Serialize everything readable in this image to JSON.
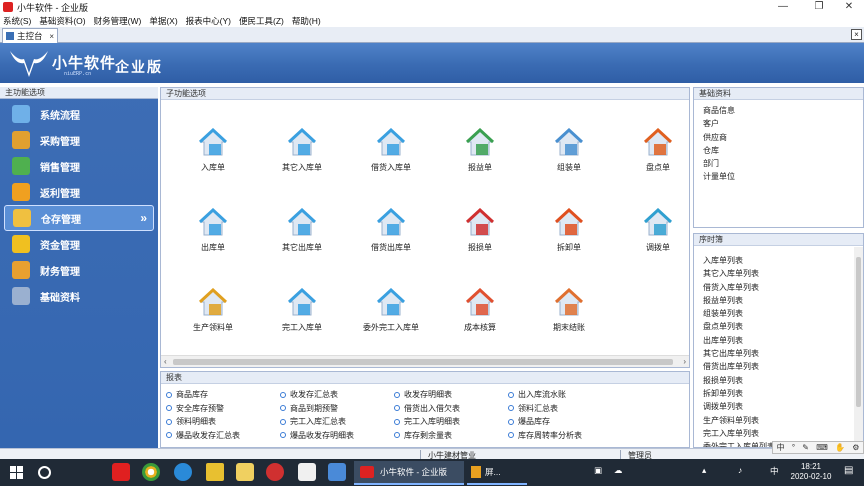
{
  "window": {
    "title": "小牛软件 - 企业版",
    "minimize": "—",
    "restore": "❐",
    "close": "✕"
  },
  "menu": [
    "系统(S)",
    "基础资料(O)",
    "财务管理(W)",
    "单据(X)",
    "报表中心(Y)",
    "便民工具(Z)",
    "帮助(H)"
  ],
  "tab": {
    "label": "主控台",
    "close": "×",
    "strip_close": "×"
  },
  "banner": {
    "brand": "小牛软件",
    "sub": "niuERP.cn",
    "edition": "企业版"
  },
  "left_nav": {
    "header": "主功能选项",
    "items": [
      {
        "label": "系统流程",
        "icon": "flow-icon",
        "color": "#6fb0e8"
      },
      {
        "label": "采购管理",
        "icon": "purchase-icon",
        "color": "#e0a030"
      },
      {
        "label": "销售管理",
        "icon": "sales-icon",
        "color": "#4fb04f"
      },
      {
        "label": "返利管理",
        "icon": "rebate-icon",
        "color": "#f0a020"
      },
      {
        "label": "仓存管理",
        "icon": "warehouse-icon",
        "color": "#f0c040",
        "active": true
      },
      {
        "label": "资金管理",
        "icon": "fund-icon",
        "color": "#f0c020"
      },
      {
        "label": "财务管理",
        "icon": "finance-icon",
        "color": "#e8a030"
      },
      {
        "label": "基础资料",
        "icon": "basic-data-icon",
        "color": "#9ab0d0"
      }
    ],
    "active_arrow": "»"
  },
  "center": {
    "header": "子功能选项",
    "functions": [
      {
        "label": "入库单",
        "icon": "stock-in-icon",
        "color": "#3aa0e0"
      },
      {
        "label": "其它入库单",
        "icon": "other-stock-in-icon",
        "color": "#3aa0e0"
      },
      {
        "label": "借货入库单",
        "icon": "borrow-stock-in-icon",
        "color": "#3aa0e0"
      },
      {
        "label": "报益单",
        "icon": "gain-report-icon",
        "color": "#3aa050"
      },
      {
        "label": "组装单",
        "icon": "assembly-icon",
        "color": "#4a90d0"
      },
      {
        "label": "盘点单",
        "icon": "inventory-count-icon",
        "color": "#e06020"
      },
      {
        "label": "出库单",
        "icon": "stock-out-icon",
        "color": "#3aa0e0"
      },
      {
        "label": "其它出库单",
        "icon": "other-stock-out-icon",
        "color": "#3aa0e0"
      },
      {
        "label": "借货出库单",
        "icon": "borrow-stock-out-icon",
        "color": "#3aa0e0"
      },
      {
        "label": "报损单",
        "icon": "loss-report-icon",
        "color": "#d03030"
      },
      {
        "label": "拆卸单",
        "icon": "disassembly-icon",
        "color": "#e05020"
      },
      {
        "label": "调拨单",
        "icon": "transfer-icon",
        "color": "#30a0d0"
      },
      {
        "label": "生产领料单",
        "icon": "material-requisition-icon",
        "color": "#e0a020"
      },
      {
        "label": "完工入库单",
        "icon": "completion-stock-in-icon",
        "color": "#3aa0e0"
      },
      {
        "label": "委外完工入库单",
        "icon": "outsource-stock-in-icon",
        "color": "#3aa0e0"
      },
      {
        "label": "成本核算",
        "icon": "cost-accounting-icon",
        "color": "#e05030"
      },
      {
        "label": "期末结账",
        "icon": "period-close-icon",
        "color": "#e07030"
      }
    ],
    "scroll_left": "‹",
    "scroll_right": "›"
  },
  "reports": {
    "header": "报表",
    "items": [
      [
        "商品库存",
        "收发存汇总表",
        "收发存明细表",
        "出入库流水账"
      ],
      [
        "安全库存预警",
        "商品到期预警",
        "借货出入借欠表",
        "领料汇总表"
      ],
      [
        "领料明细表",
        "完工入库汇总表",
        "完工入库明细表",
        "爆品库存"
      ],
      [
        "爆品收发存汇总表",
        "爆品收发存明细表",
        "库存剩余量表",
        "库存周转率分析表"
      ]
    ]
  },
  "basic_data": {
    "header": "基础资料",
    "items": [
      "商品信息",
      "客户",
      "供应商",
      "仓库",
      "部门",
      "计量单位"
    ]
  },
  "timing": {
    "header": "序时簿",
    "items": [
      "入库单列表",
      "其它入库单列表",
      "借货入库单列表",
      "报益单列表",
      "组装单列表",
      "盘点单列表",
      "出库单列表",
      "其它出库单列表",
      "借货出库单列表",
      "报损单列表",
      "拆卸单列表",
      "调拨单列表",
      "生产领料单列表",
      "完工入库单列表",
      "委外完工入库单列表"
    ]
  },
  "status": {
    "company": "小牛建材管业",
    "user": "管理员"
  },
  "ime": [
    "中",
    "°",
    "✎",
    "⌨",
    "✋",
    "⚙"
  ],
  "taskbar": {
    "active_app": "小牛软件 - 企业版",
    "second_app": "屏...",
    "tray_input": "中",
    "time": "18:21",
    "date": "2020-02-10"
  }
}
